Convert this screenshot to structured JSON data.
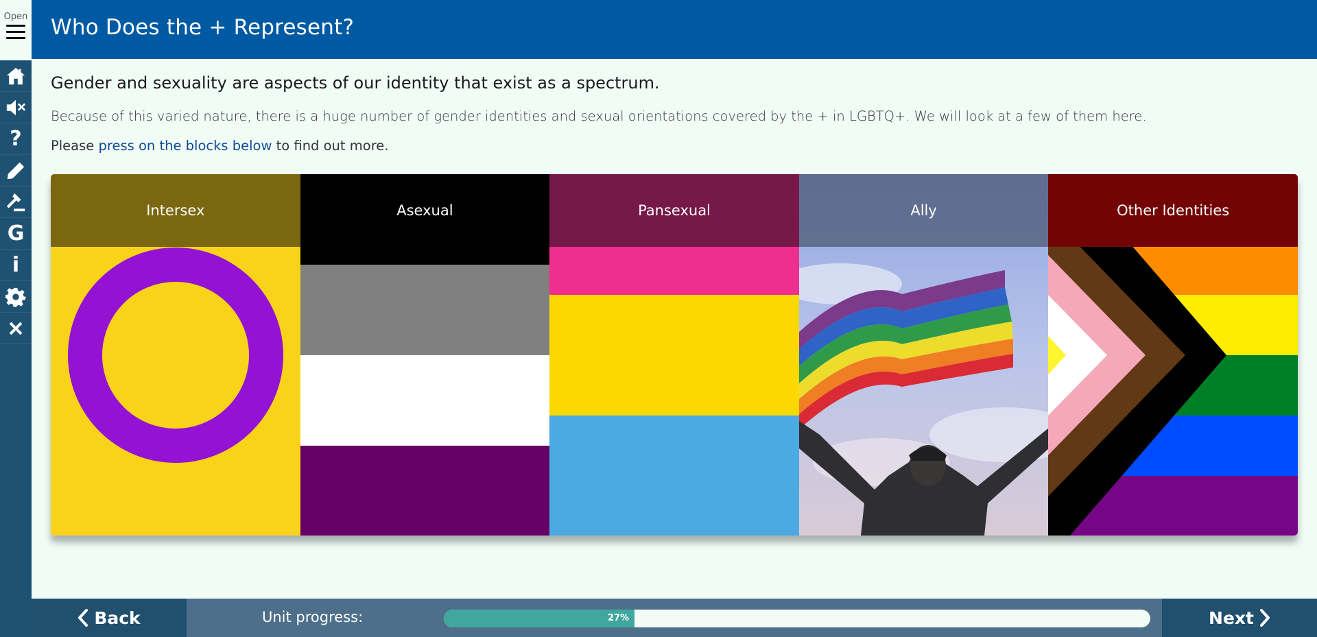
{
  "sidebar": {
    "open_label": "Open",
    "icons": [
      "home-icon",
      "mute-icon",
      "help-icon",
      "pencil-icon",
      "gavel-icon",
      "glossary-icon",
      "info-icon",
      "settings-icon",
      "close-icon"
    ],
    "glossary_glyph": "G",
    "help_glyph": "?",
    "info_glyph": "i"
  },
  "header": {
    "title": "Who Does the + Represent?"
  },
  "content": {
    "lead": "Gender and sexuality are aspects of our identity that exist as a spectrum.",
    "paragraph": "Because of this varied nature, there is a huge number of gender identities and sexual orientations covered by the + in LGBTQ+. We will look at a few of them here.",
    "instruction_pre": "Please ",
    "instruction_link": "press on the blocks below",
    "instruction_post": " to find out more."
  },
  "blocks": [
    {
      "label": "Intersex",
      "bar_color": "#7b6710",
      "bg": "#f9d31a",
      "ring": "#9412d4"
    },
    {
      "label": "Asexual",
      "bar_color": "#000000",
      "stripes": [
        "#000000",
        "#808080",
        "#ffffff",
        "#660066"
      ]
    },
    {
      "label": "Pansexual",
      "bar_color": "#761948",
      "stripes": [
        "#ee2f8f",
        "#fbd800",
        "#4aaae1"
      ]
    },
    {
      "label": "Ally",
      "bar_color": "#55607d"
    },
    {
      "label": "Other Identities",
      "bar_color": "#720404",
      "stripes": [
        "#e40303",
        "#ff8c00",
        "#ffed00",
        "#008026",
        "#004dff",
        "#750787"
      ]
    }
  ],
  "footer": {
    "back_label": "Back",
    "next_label": "Next",
    "progress_label": "Unit progress:",
    "progress_text": "27%",
    "progress_value": 0.27
  },
  "colors": {
    "header": "#005aa3",
    "sidebar": "#1f5272",
    "footer": "#4d6f8a",
    "progress": "#3fa79e",
    "link": "#0f4c93"
  }
}
